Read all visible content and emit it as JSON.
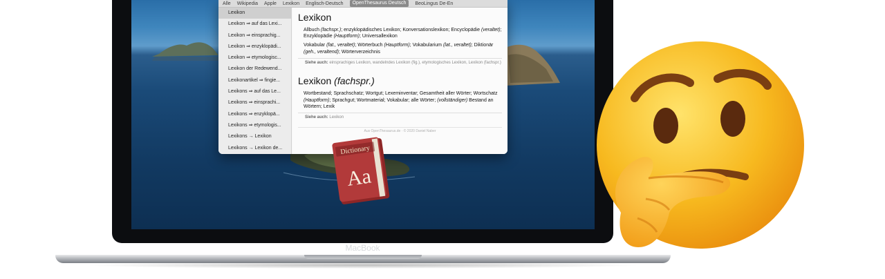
{
  "dictionary_window": {
    "tabs": [
      {
        "label": "Alle"
      },
      {
        "label": "Wikipedia"
      },
      {
        "label": "Apple"
      },
      {
        "label": "Lexikon"
      },
      {
        "label": "Englisch-Deutsch"
      },
      {
        "label": "OpenThesaurus Deutsch",
        "active": true
      },
      {
        "label": "BeoLingus De-En"
      }
    ],
    "sidebar": [
      "Lexikon",
      "Lexikon ⇒ auf das Lexi...",
      "Lexikon ⇒ einsprachig...",
      "Lexikon ⇒ enzyklopädi...",
      "Lexikon ⇒ etymologisc...",
      "Lexikon der Redewend...",
      "Lexikonartikel ⇒ fingie...",
      "Lexikons ⇒ auf das Le...",
      "Lexikons ⇒ einsprachi...",
      "Lexikons ⇒ enzyklopä...",
      "Lexikons ⇒ etymologis...",
      "Lexikons → Lexikon",
      "Lexikons → Lexikon de..."
    ],
    "entry1": {
      "title": "Lexikon",
      "para1_a": "Allbuch ",
      "para1_a_it": "(fachspr.)",
      "para1_b": "; enzyklopädisches Lexikon; Konversationslexikon; Encyclopädie ",
      "para1_b_it": "(veraltet)",
      "para1_c": "; Enzyklopädie ",
      "para1_c_it": "(Hauptform)",
      "para1_d": "; Universallexikon",
      "para2_a": "Vokabular ",
      "para2_a_it": "(fat., veraltet)",
      "para2_b": "; Wörterbuch ",
      "para2_b_it": "(Hauptform)",
      "para2_c": "; Vokabularium ",
      "para2_c_it": "(lat., veraltet)",
      "para2_d": "; Diktionär ",
      "para2_d_it": "(geh., veraltend)",
      "para2_e": "; Wörterverzeichnis",
      "see_label": "Siehe auch:",
      "see_text": " einsprachiges Lexikon, wandelndes Lexikon (fig.), etymologisches Lexikon, Lexikon (fachspr.)"
    },
    "entry2": {
      "title": "Lexikon ",
      "title_it": "(fachspr.)",
      "para_a": "Wortbestand; Sprachschatz; Wortgut; Lexeminventar; Gesamtheit aller Wörter; Wortschatz ",
      "para_a_it": "(Hauptform)",
      "para_b": "; Sprachgut; Wortmaterial; Vokabular; alle Wörter; ",
      "para_b_it": "(vollständiger)",
      "para_c": " Bestand an Wörtern; Lexik",
      "see_label": "Siehe auch:",
      "see_text": " Lexikon"
    },
    "footer": "Aus OpenThesaurus.de · © 2020 Daniel Naber"
  },
  "dictionary_icon": {
    "label": "Dictionary",
    "letters": "Aa"
  },
  "laptop": {
    "brand": "MacBook"
  },
  "emoji": {
    "name": "thinking-face"
  },
  "colors": {
    "active_tab": "#8a8a8a",
    "book_red": "#b23a3a",
    "emoji_yellow": "#f6b51e"
  }
}
